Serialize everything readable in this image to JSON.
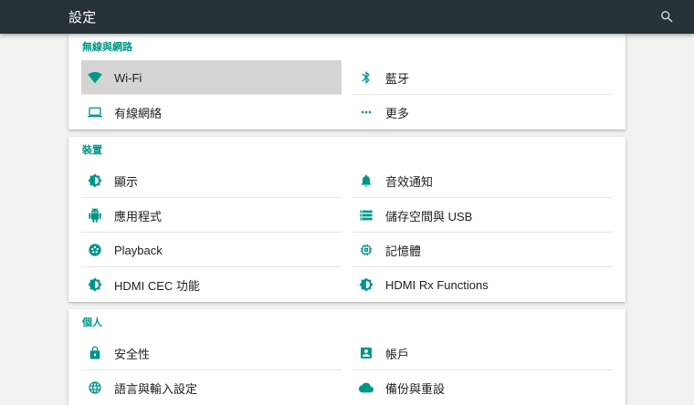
{
  "app_bar": {
    "title": "設定",
    "search_icon": "search"
  },
  "colors": {
    "accent": "#009688",
    "app_bar_bg": "#263238",
    "page_bg": "#f2f2f2",
    "selected_bg": "#d4d4d4"
  },
  "sections": [
    {
      "header": "無線與網路",
      "left": [
        {
          "label": "Wi-Fi",
          "icon": "wifi",
          "selected": true
        },
        {
          "label": "有線網絡",
          "icon": "laptop"
        }
      ],
      "right": [
        {
          "label": "藍牙",
          "icon": "bluetooth"
        },
        {
          "label": "更多",
          "icon": "more-horiz"
        }
      ]
    },
    {
      "header": "裝置",
      "left": [
        {
          "label": "顯示",
          "icon": "brightness"
        },
        {
          "label": "應用程式",
          "icon": "android"
        },
        {
          "label": "Playback",
          "icon": "film-reel"
        },
        {
          "label": "HDMI CEC 功能",
          "icon": "brightness"
        }
      ],
      "right": [
        {
          "label": "音效通知",
          "icon": "bell"
        },
        {
          "label": "儲存空間與 USB",
          "icon": "storage"
        },
        {
          "label": "記憶體",
          "icon": "memory"
        },
        {
          "label": "HDMI Rx Functions",
          "icon": "brightness"
        }
      ]
    },
    {
      "header": "個人",
      "left": [
        {
          "label": "安全性",
          "icon": "lock"
        },
        {
          "label": "語言與輸入設定",
          "icon": "globe"
        }
      ],
      "right": [
        {
          "label": "帳戶",
          "icon": "account-box"
        },
        {
          "label": "備份與重設",
          "icon": "cloud-backup"
        }
      ]
    }
  ]
}
